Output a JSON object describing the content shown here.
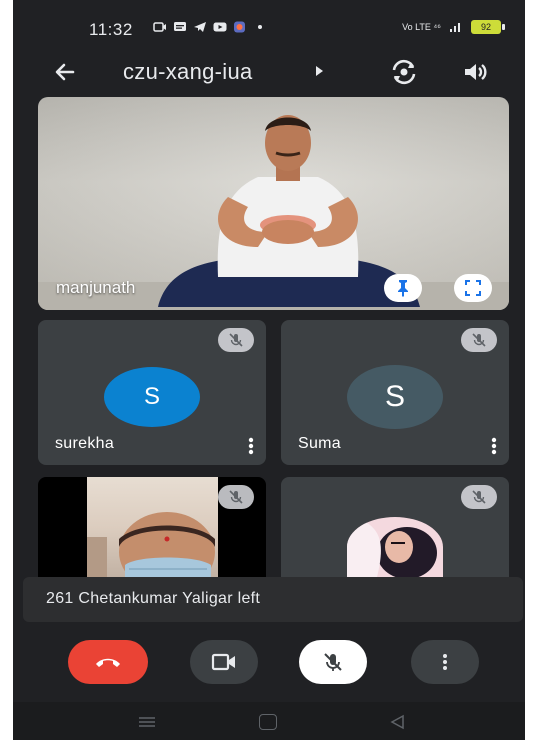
{
  "status_bar": {
    "time": "11:32",
    "network": "Vo LTE ⁴⁶",
    "battery": "92"
  },
  "header": {
    "meeting_code": "czu-xang-iua"
  },
  "main_tile": {
    "name": "manjunath"
  },
  "participants": [
    {
      "name": "surekha",
      "initial": "S",
      "color": "#0b82d0",
      "muted": true
    },
    {
      "name": "Suma",
      "initial": "S",
      "color": "#455a64",
      "muted": true
    },
    {
      "name": "",
      "muted": true
    },
    {
      "name": "",
      "muted": true
    }
  ],
  "toast": {
    "message": "261 Chetankumar Yaligar left"
  },
  "controls": {
    "end_call_color": "#ea4335",
    "camera": "camera-off",
    "microphone": "mic-off"
  }
}
